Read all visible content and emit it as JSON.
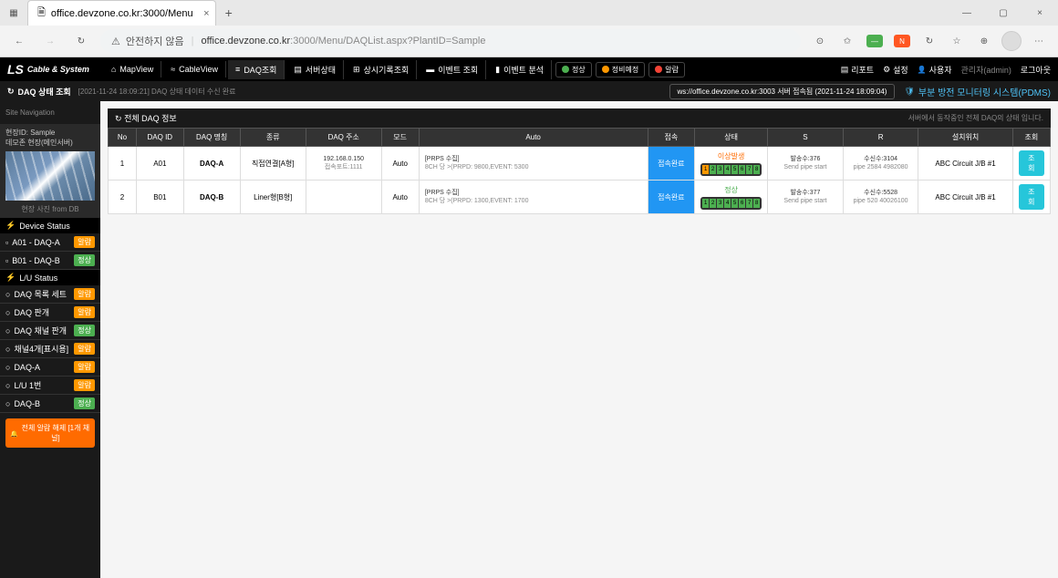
{
  "browser": {
    "tab_title": "office.devzone.co.kr:3000/Menu",
    "security_text": "안전하지 않음",
    "url_host": "office.devzone.co.kr",
    "url_path": ":3000/Menu/DAQList.aspx?PlantID=Sample"
  },
  "header": {
    "logo_main": "LS",
    "logo_sub": "Cable & System",
    "menu": [
      {
        "icon": "i-home",
        "label": "MapView"
      },
      {
        "icon": "i-cable",
        "label": "CableView"
      },
      {
        "icon": "i-list",
        "label": "DAQ조회"
      },
      {
        "icon": "i-doc",
        "label": "서버상태"
      },
      {
        "icon": "i-grid",
        "label": "상시기록조회"
      },
      {
        "icon": "i-chat",
        "label": "이벤트 조회"
      },
      {
        "icon": "i-chart",
        "label": "이벤트 분석"
      }
    ],
    "pills": [
      {
        "color": "#4caf50",
        "label": "정상"
      },
      {
        "color": "#ff9800",
        "label": "정비예정"
      },
      {
        "color": "#f44336",
        "label": "알람"
      }
    ],
    "right": [
      {
        "icon": "i-doc",
        "label": "리포트"
      },
      {
        "icon": "i-gear",
        "label": "설정"
      },
      {
        "icon": "i-user",
        "label": "사용자"
      }
    ],
    "admin": "관리자(admin)",
    "logout": "로그아웃"
  },
  "subheader": {
    "title": "DAQ 상태 조회",
    "info": "[2021-11-24 18:09:21] DAQ 상태 데이터 수신 완료",
    "server": "ws://office.devzone.co.kr:3003 서버 접속됨 (2021-11-24 18:09:04)",
    "pdms": "부분 방전 모니터링 시스템(PDMS)"
  },
  "sidebar": {
    "nav_title": "Site Navigation",
    "field_id_label": "현장ID:",
    "field_id": "Sample",
    "field_name": "데모존 현장(메인서버)",
    "image_caption": "현장 사진 from DB",
    "device_status_title": "Device Status",
    "devices": [
      {
        "label": "A01 - DAQ-A",
        "badge": "알람",
        "badge_class": "orange"
      },
      {
        "label": "B01 - DAQ-B",
        "badge": "정상",
        "badge_class": "green"
      }
    ],
    "lu_status_title": "L/U Status",
    "lu_items": [
      {
        "label": "DAQ 목록 세트",
        "badge": "알람",
        "badge_class": "orange"
      },
      {
        "label": "DAQ 판개",
        "badge": "알람",
        "badge_class": "orange"
      },
      {
        "label": "DAQ 채널 판개",
        "badge": "정상",
        "badge_class": "green"
      },
      {
        "label": "채널4개[표시용]",
        "badge": "알람",
        "badge_class": "orange"
      },
      {
        "label": "DAQ-A",
        "badge": "알람",
        "badge_class": "orange"
      },
      {
        "label": "L/U 1번",
        "badge": "알람",
        "badge_class": "orange"
      },
      {
        "label": "DAQ-B",
        "badge": "정상",
        "badge_class": "green"
      }
    ],
    "alarm_btn": "전체 알람 해제 [1개 채널]"
  },
  "panel": {
    "title": "전체 DAQ 정보",
    "note": "서버에서 동작중인 전체 DAQ의 상태 입니다."
  },
  "table": {
    "headers": [
      "No",
      "DAQ ID",
      "DAQ 명칭",
      "종류",
      "DAQ 주소",
      "모드",
      "Auto",
      "접속",
      "상태",
      "S",
      "R",
      "설치위치",
      "조회"
    ],
    "rows": [
      {
        "no": "1",
        "id": "A01",
        "name": "DAQ-A",
        "type": "직접연결[A형]",
        "addr_line1": "192.168.0.150",
        "addr_line2": "접속포트:1111",
        "mode": "Auto",
        "auto_line1": "[PRPS 수집]",
        "auto_line2": "  8CH 당 >(PRPD: 9800,EVENT: 5300",
        "conn": "접속완료",
        "status_label": "이상발생",
        "status_class": "warn",
        "leds": [
          1,
          2,
          3,
          4,
          5,
          6,
          7,
          8
        ],
        "led_first": "orange",
        "s_line1": "발송수:376",
        "s_line2": "Send pipe start",
        "r_line1": "수신수:3104",
        "r_line2": "pipe 2584 4982080",
        "location": "ABC Circuit J/B #1",
        "view": "조회"
      },
      {
        "no": "2",
        "id": "B01",
        "name": "DAQ-B",
        "type": "Liner형[B형]",
        "addr_line1": "",
        "addr_line2": "",
        "mode": "Auto",
        "auto_line1": "[PRPS 수집]",
        "auto_line2": "  8CH 당 >(PRPD: 1300,EVENT: 1700",
        "conn": "접속완료",
        "status_label": "정상",
        "status_class": "ok",
        "leds": [
          1,
          2,
          3,
          4,
          5,
          6,
          7,
          8
        ],
        "led_first": "green",
        "s_line1": "발송수:377",
        "s_line2": "Send pipe start",
        "r_line1": "수신수:5528",
        "r_line2": "pipe 520 40026100",
        "location": "ABC Circuit J/B #1",
        "view": "조회"
      }
    ]
  }
}
